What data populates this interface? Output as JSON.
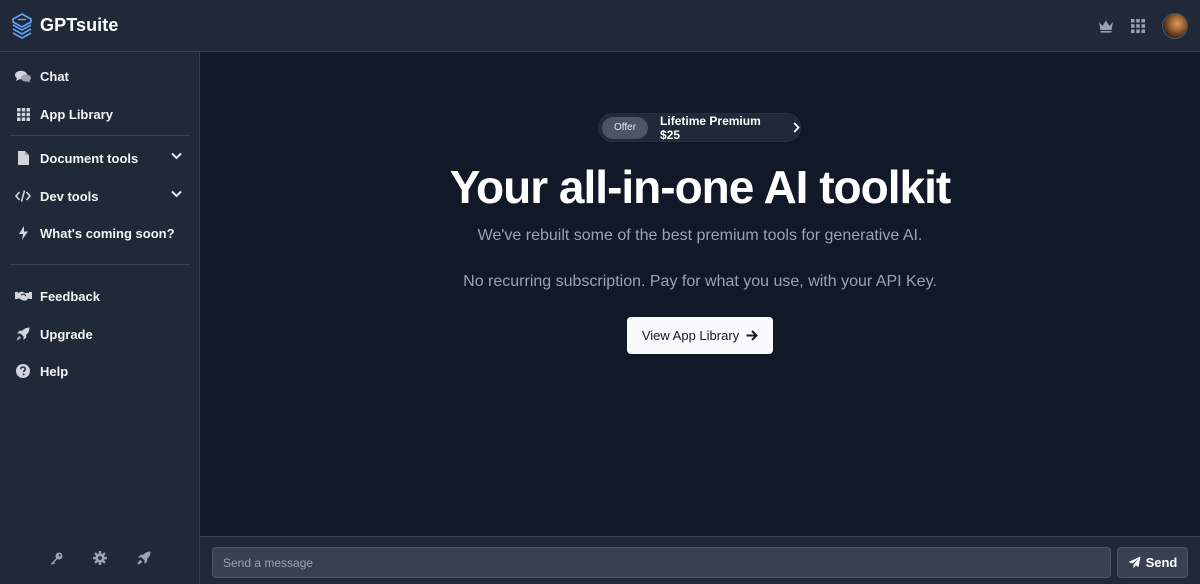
{
  "app": {
    "name": "GPTsuite"
  },
  "header": {
    "icons": [
      "crown-icon",
      "grid-icon",
      "avatar"
    ]
  },
  "sidebar": {
    "items": [
      {
        "label": "Chat",
        "icon": "chat-icon"
      },
      {
        "label": "App Library",
        "icon": "grid-icon"
      },
      {
        "label": "Document tools",
        "icon": "document-icon",
        "expandable": true
      },
      {
        "label": "Dev tools",
        "icon": "code-icon",
        "expandable": true
      },
      {
        "label": "What's coming soon?",
        "icon": "bolt-icon"
      },
      {
        "label": "Feedback",
        "icon": "handshake-icon"
      },
      {
        "label": "Upgrade",
        "icon": "rocket-icon"
      },
      {
        "label": "Help",
        "icon": "question-icon"
      }
    ],
    "footer_icons": [
      "key-icon",
      "gear-icon",
      "rocket-icon"
    ]
  },
  "hero": {
    "offer_tag": "Offer",
    "offer_text": "Lifetime Premium $25",
    "title": "Your all-in-one AI toolkit",
    "subtitle": "We've rebuilt some of the best premium tools for generative AI.",
    "subtitle2": "No recurring subscription. Pay for what you use, with your API Key.",
    "cta_label": "View App Library"
  },
  "composer": {
    "placeholder": "Send a message",
    "send_label": "Send"
  },
  "colors": {
    "background": "#111827",
    "panel": "#1f2937",
    "border": "#374151",
    "text_muted": "#9ca3af"
  }
}
